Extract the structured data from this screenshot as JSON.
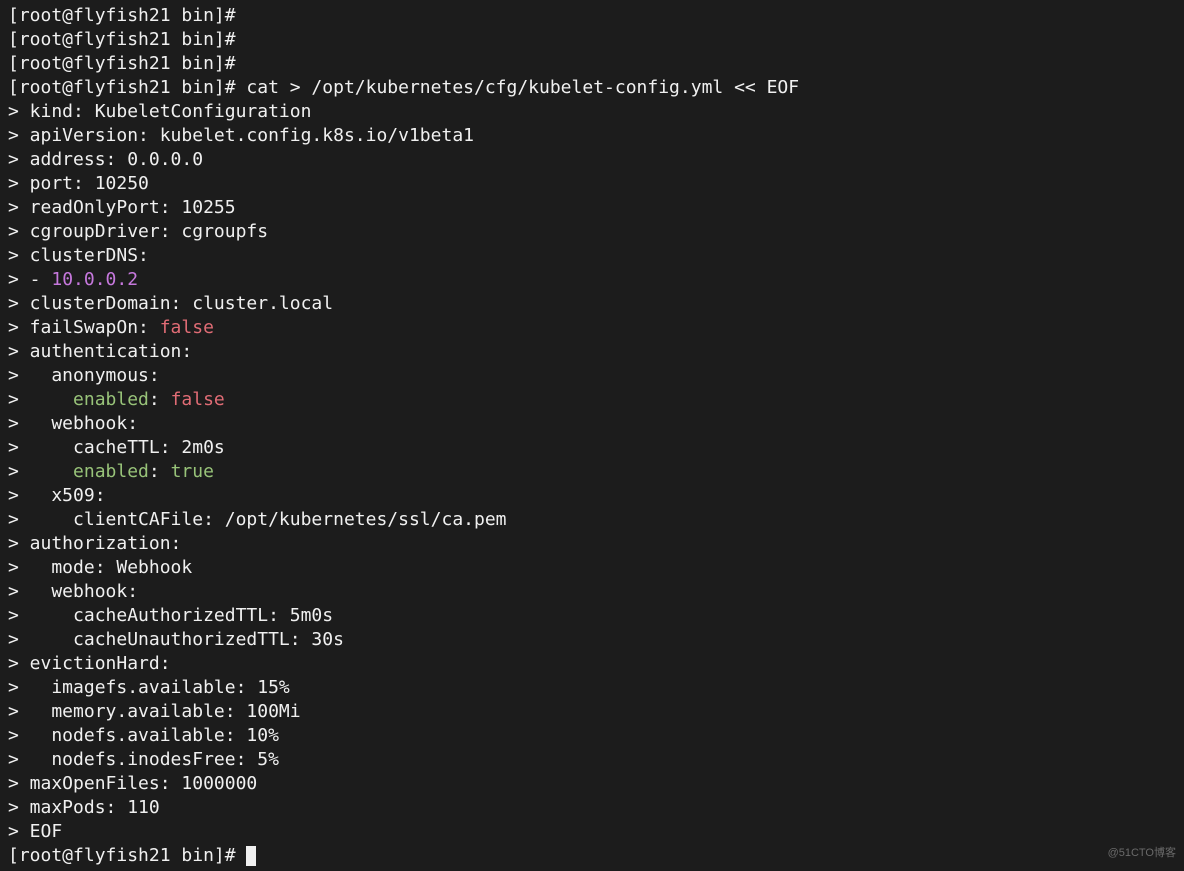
{
  "watermark": "@51CTO博客",
  "lines": [
    {
      "segs": [
        {
          "t": "[root@flyfish21 bin]#",
          "c": "white"
        }
      ]
    },
    {
      "segs": [
        {
          "t": "[root@flyfish21 bin]#",
          "c": "white"
        }
      ]
    },
    {
      "segs": [
        {
          "t": "[root@flyfish21 bin]#",
          "c": "white"
        }
      ]
    },
    {
      "segs": [
        {
          "t": "[root@flyfish21 bin]# cat > /opt/kubernetes/cfg/kubelet-config.yml << EOF",
          "c": "white"
        }
      ]
    },
    {
      "segs": [
        {
          "t": "> kind: KubeletConfiguration",
          "c": "white"
        }
      ]
    },
    {
      "segs": [
        {
          "t": "> apiVersion: kubelet.config.k8s.io/v1beta1",
          "c": "white"
        }
      ]
    },
    {
      "segs": [
        {
          "t": "> address: 0.0.0.0",
          "c": "white"
        }
      ]
    },
    {
      "segs": [
        {
          "t": "> port: 10250",
          "c": "white"
        }
      ]
    },
    {
      "segs": [
        {
          "t": "> readOnlyPort: 10255",
          "c": "white"
        }
      ]
    },
    {
      "segs": [
        {
          "t": "> cgroupDriver: cgroupfs",
          "c": "white"
        }
      ]
    },
    {
      "segs": [
        {
          "t": "> clusterDNS:",
          "c": "white"
        }
      ]
    },
    {
      "segs": [
        {
          "t": "> - ",
          "c": "white"
        },
        {
          "t": "10.0.0.2",
          "c": "magenta"
        }
      ]
    },
    {
      "segs": [
        {
          "t": "> clusterDomain: cluster.local",
          "c": "white"
        }
      ]
    },
    {
      "segs": [
        {
          "t": "> failSwapOn: ",
          "c": "white"
        },
        {
          "t": "false",
          "c": "red"
        }
      ]
    },
    {
      "segs": [
        {
          "t": "> authentication:",
          "c": "white"
        }
      ]
    },
    {
      "segs": [
        {
          "t": ">   anonymous:",
          "c": "white"
        }
      ]
    },
    {
      "segs": [
        {
          "t": ">     ",
          "c": "white"
        },
        {
          "t": "enabled",
          "c": "green"
        },
        {
          "t": ": ",
          "c": "white"
        },
        {
          "t": "false",
          "c": "red"
        }
      ]
    },
    {
      "segs": [
        {
          "t": ">   webhook:",
          "c": "white"
        }
      ]
    },
    {
      "segs": [
        {
          "t": ">     cacheTTL: 2m0s",
          "c": "white"
        }
      ]
    },
    {
      "segs": [
        {
          "t": ">     ",
          "c": "white"
        },
        {
          "t": "enabled",
          "c": "green"
        },
        {
          "t": ": ",
          "c": "white"
        },
        {
          "t": "true",
          "c": "green"
        }
      ]
    },
    {
      "segs": [
        {
          "t": ">   x509:",
          "c": "white"
        }
      ]
    },
    {
      "segs": [
        {
          "t": ">     clientCAFile: /opt/kubernetes/ssl/ca.pem",
          "c": "white"
        }
      ]
    },
    {
      "segs": [
        {
          "t": "> authorization:",
          "c": "white"
        }
      ]
    },
    {
      "segs": [
        {
          "t": ">   mode: Webhook",
          "c": "white"
        }
      ]
    },
    {
      "segs": [
        {
          "t": ">   webhook:",
          "c": "white"
        }
      ]
    },
    {
      "segs": [
        {
          "t": ">     cacheAuthorizedTTL: 5m0s",
          "c": "white"
        }
      ]
    },
    {
      "segs": [
        {
          "t": ">     cacheUnauthorizedTTL: 30s",
          "c": "white"
        }
      ]
    },
    {
      "segs": [
        {
          "t": "> evictionHard:",
          "c": "white"
        }
      ]
    },
    {
      "segs": [
        {
          "t": ">   imagefs.available: 15%",
          "c": "white"
        }
      ]
    },
    {
      "segs": [
        {
          "t": ">   memory.available: 100Mi",
          "c": "white"
        }
      ]
    },
    {
      "segs": [
        {
          "t": ">   nodefs.available: 10%",
          "c": "white"
        }
      ]
    },
    {
      "segs": [
        {
          "t": ">   nodefs.inodesFree: 5%",
          "c": "white"
        }
      ]
    },
    {
      "segs": [
        {
          "t": "> maxOpenFiles: 1000000",
          "c": "white"
        }
      ]
    },
    {
      "segs": [
        {
          "t": "> maxPods: 110",
          "c": "white"
        }
      ]
    },
    {
      "segs": [
        {
          "t": "> EOF",
          "c": "white"
        }
      ]
    },
    {
      "segs": [
        {
          "t": "[root@flyfish21 bin]# ",
          "c": "white"
        }
      ],
      "cursor": true
    }
  ]
}
